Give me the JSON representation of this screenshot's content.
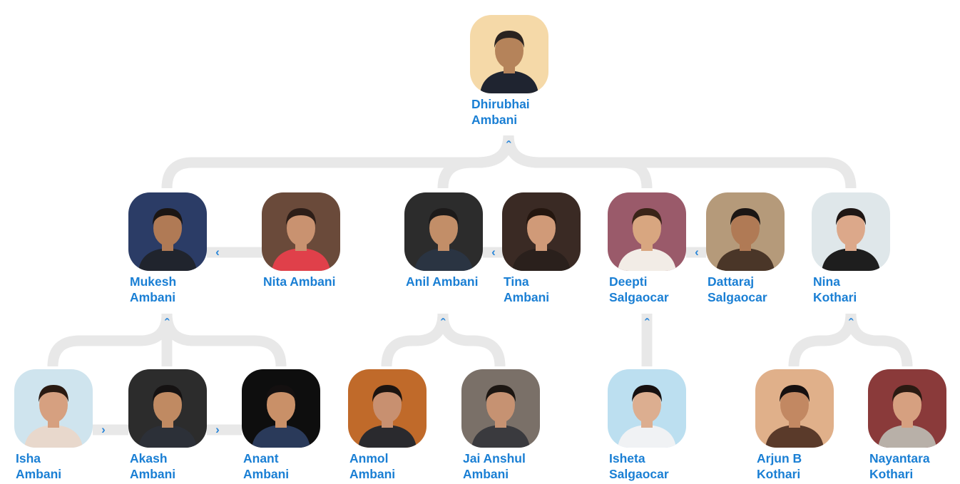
{
  "people": {
    "dhirubhai": {
      "name": "Dhirubhai Ambani",
      "icon": "person-portrait-icon"
    },
    "mukesh": {
      "name": "Mukesh Ambani",
      "icon": "person-portrait-icon"
    },
    "nita": {
      "name": "Nita Ambani",
      "icon": "person-portrait-icon"
    },
    "anil": {
      "name": "Anil Ambani",
      "icon": "person-portrait-icon"
    },
    "tina": {
      "name": "Tina Ambani",
      "icon": "person-portrait-icon"
    },
    "deepti": {
      "name": "Deepti Salgaocar",
      "icon": "person-portrait-icon"
    },
    "dattaraj": {
      "name": "Dattaraj Salgaocar",
      "icon": "person-portrait-icon"
    },
    "nina": {
      "name": "Nina Kothari",
      "icon": "person-portrait-icon"
    },
    "isha": {
      "name": "Isha Ambani",
      "icon": "person-portrait-icon"
    },
    "akash": {
      "name": "Akash Ambani",
      "icon": "person-portrait-icon"
    },
    "anant": {
      "name": "Anant Ambani",
      "icon": "person-portrait-icon"
    },
    "anmol": {
      "name": "Anmol Ambani",
      "icon": "person-portrait-icon"
    },
    "jai": {
      "name": "Jai Anshul Ambani",
      "icon": "person-portrait-icon"
    },
    "isheta": {
      "name": "Isheta Salgaocar",
      "icon": "person-portrait-icon"
    },
    "arjun": {
      "name": "Arjun B Kothari",
      "icon": "person-portrait-icon"
    },
    "nayantara": {
      "name": "Nayantara Kothari",
      "icon": "person-portrait-icon"
    }
  },
  "controls": {
    "collapse_glyph": "^",
    "spouse_glyph": "<",
    "sibling_glyph": ">"
  },
  "colors": {
    "name_text": "#1a7fd4",
    "chevron": "#2a86d8",
    "connector": "#e8e8e8",
    "background": "#ffffff"
  }
}
